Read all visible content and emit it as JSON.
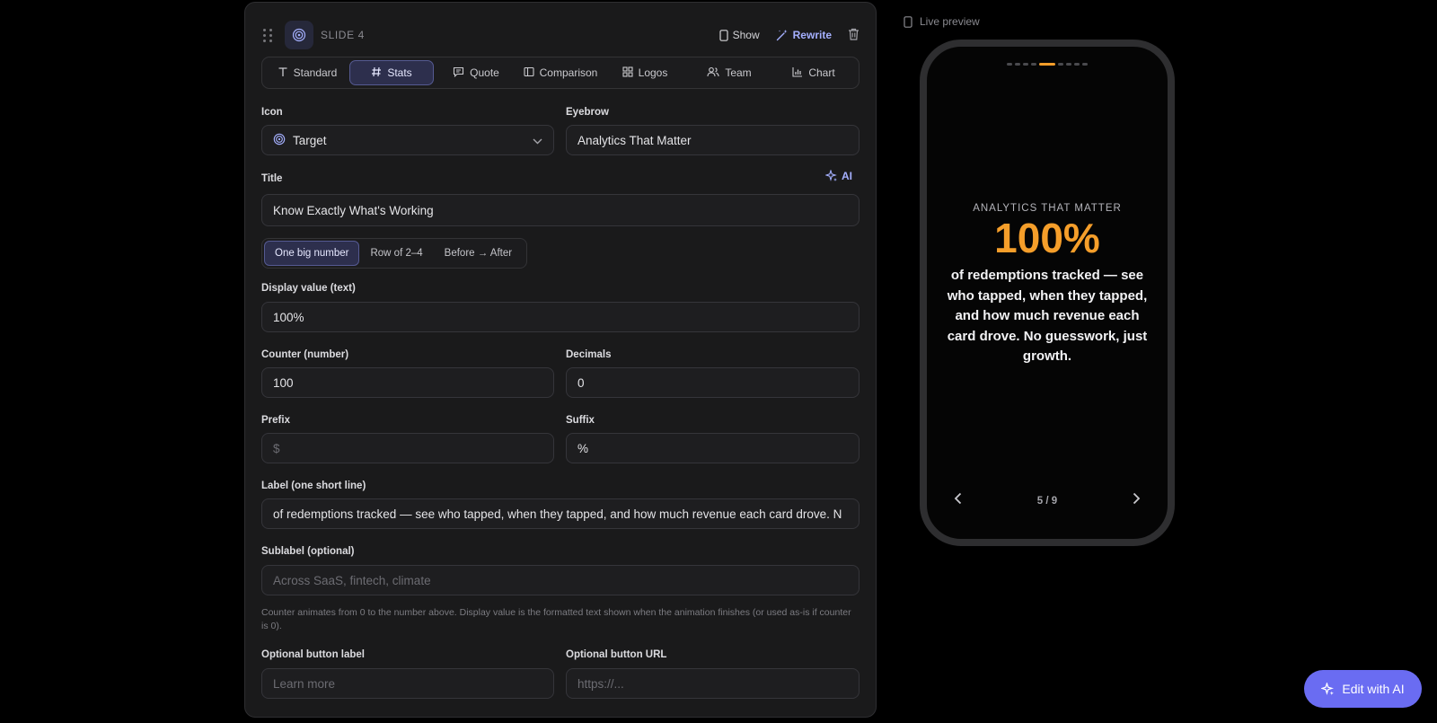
{
  "editor": {
    "slide_label": "SLIDE 4",
    "actions": {
      "show": "Show",
      "rewrite": "Rewrite"
    },
    "tabs": [
      {
        "label": "Standard",
        "icon": "text-type-icon"
      },
      {
        "label": "Stats",
        "icon": "hash-icon",
        "active": true
      },
      {
        "label": "Quote",
        "icon": "quote-bubble-icon"
      },
      {
        "label": "Comparison",
        "icon": "columns-icon"
      },
      {
        "label": "Logos",
        "icon": "grid-icon"
      },
      {
        "label": "Team",
        "icon": "users-icon"
      },
      {
        "label": "Chart",
        "icon": "bar-chart-icon"
      }
    ],
    "icon_field": {
      "label": "Icon",
      "value": "Target"
    },
    "eyebrow_field": {
      "label": "Eyebrow",
      "value": "Analytics That Matter"
    },
    "title_field": {
      "label": "Title",
      "value": "Know Exactly What's Working",
      "ai_label": "AI"
    },
    "layout_options": [
      "One big number",
      "Row of 2–4",
      "Before → After"
    ],
    "display_value": {
      "label": "Display value (text)",
      "value": "100%"
    },
    "counter": {
      "label": "Counter (number)",
      "value": "100"
    },
    "decimals": {
      "label": "Decimals",
      "value": "0"
    },
    "prefix": {
      "label": "Prefix",
      "placeholder": "$"
    },
    "suffix": {
      "label": "Suffix",
      "value": "%"
    },
    "label_field": {
      "label": "Label (one short line)",
      "value": "of redemptions tracked — see who tapped, when they tapped, and how much revenue each card drove. N"
    },
    "sublabel": {
      "label": "Sublabel (optional)",
      "placeholder": "Across SaaS, fintech, climate"
    },
    "help_text": "Counter animates from 0 to the number above. Display value is the formatted text shown when the animation finishes (or used as-is if counter is 0).",
    "button_label": {
      "label": "Optional button label",
      "placeholder": "Learn more"
    },
    "button_url": {
      "label": "Optional button URL",
      "placeholder": "https://..."
    }
  },
  "preview": {
    "header": "Live preview",
    "eyebrow": "ANALYTICS THAT MATTER",
    "big_value": "100%",
    "label_text": "of redemptions tracked — see who tapped, when they tapped, and how much revenue each card drove. No guesswork, just growth.",
    "counter": "5 / 9",
    "total_slides": 9,
    "current_index": 5
  },
  "edit_ai": {
    "label": "Edit with AI"
  },
  "colors": {
    "accent": "#6a6cf2",
    "highlight": "#f59e2a",
    "active_tab_bg": "#2d2f4d"
  }
}
